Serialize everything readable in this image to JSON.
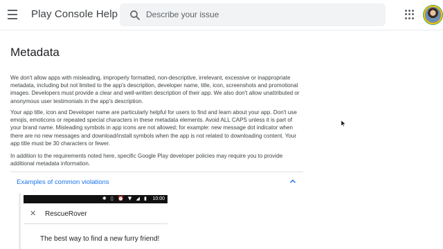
{
  "header": {
    "menu_icon": "hamburger-menu-icon",
    "title": "Play Console Help",
    "search_placeholder": "Describe your issue",
    "apps_icon": "apps-grid-icon",
    "avatar_icon": "account-avatar"
  },
  "article": {
    "title": "Metadata",
    "paragraphs": [
      "We don't allow apps with misleading, improperly formatted, non-descriptive, irrelevant, excessive or inappropriate metadata, including but not limited to the app's description, developer name, title, icon, screenshots and promotional images. Developers must provide a clear and well-written description of their app. We also don't allow unattributed or anonymous user testimonials in the app's description.",
      "Your app title, icon and Developer name are particularly helpful for users to find and learn about your app. Don't use emojis, emoticons or repeated special characters in these metadata elements. Avoid ALL CAPS unless it is part of your brand name. Misleading symbols in app icons are not allowed; for example: new message dot indicator when there are no new messages and download/install symbols when the app is not related to downloading content. Your app title must be 30 characters or fewer.",
      "In addition to the requirements noted here, specific Google Play developer policies may require you to provide additional metadata information."
    ],
    "accordion": {
      "label": "Examples of common violations",
      "state": "expanded",
      "chevron_icon": "chevron-up-icon"
    },
    "example": {
      "status_icons": "✱ ▯ ⏰ ▼ ◢ ▮",
      "status_time": "10:00",
      "close_icon": "close-icon",
      "app_name": "RescueRover",
      "tagline": "The best way to find a new furry friend!"
    }
  },
  "colors": {
    "link": "#1a73e8",
    "text": "#202124",
    "search_bg": "#f1f3f4"
  }
}
